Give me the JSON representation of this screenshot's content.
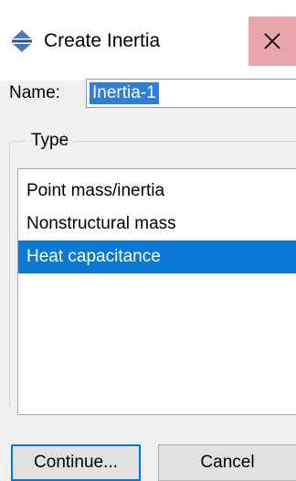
{
  "dialog": {
    "title": "Create Inertia",
    "title_icon": "inertia-icon",
    "close_icon": "close-icon"
  },
  "name_field": {
    "label": "Name:",
    "value": "Inertia-1"
  },
  "type_group": {
    "legend": "Type",
    "items": [
      {
        "label": "Point mass/inertia",
        "selected": false
      },
      {
        "label": "Nonstructural mass",
        "selected": false
      },
      {
        "label": "Heat capacitance",
        "selected": true
      }
    ]
  },
  "buttons": {
    "continue_label": "Continue...",
    "cancel_label": "Cancel"
  },
  "colors": {
    "selection": "#0a79d6",
    "close_hover": "#e8a5aa",
    "focus_border": "#0078d7"
  }
}
